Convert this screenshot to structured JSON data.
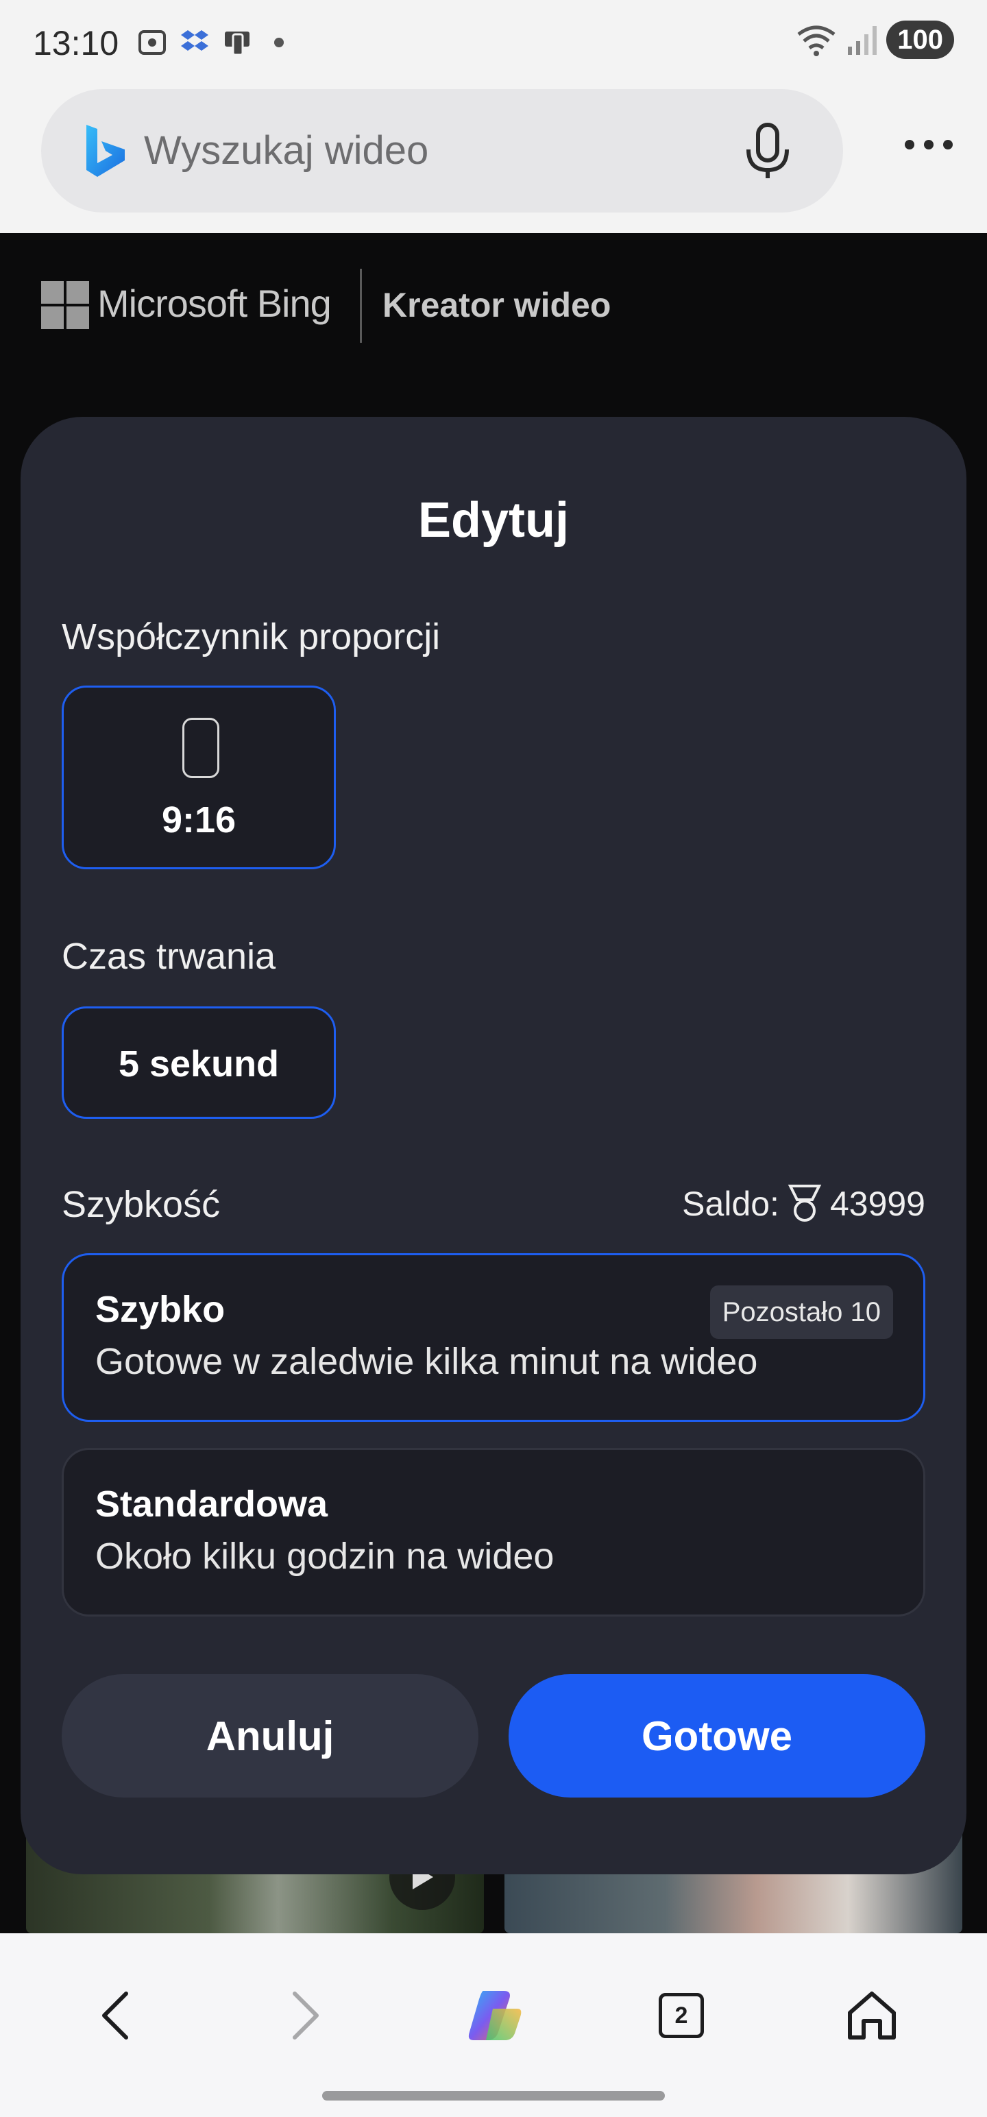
{
  "status_bar": {
    "time": "13:10",
    "battery": "100"
  },
  "browser": {
    "search_placeholder": "Wyszukaj wideo"
  },
  "header": {
    "brand": "Microsoft Bing",
    "section": "Kreator wideo"
  },
  "modal": {
    "title": "Edytuj",
    "aspect_ratio": {
      "label": "Współczynnik proporcji",
      "value": "9:16"
    },
    "duration": {
      "label": "Czas trwania",
      "value": "5 sekund"
    },
    "speed": {
      "label": "Szybkość",
      "balance_prefix": "Saldo:",
      "balance_value": "43999",
      "options": [
        {
          "name": "Szybko",
          "description": "Gotowe w zaledwie kilka minut na wideo",
          "badge": "Pozostało 10"
        },
        {
          "name": "Standardowa",
          "description": "Około kilku godzin na wideo"
        }
      ]
    },
    "buttons": {
      "cancel": "Anuluj",
      "done": "Gotowe"
    }
  },
  "bottom_nav": {
    "tabs_count": "2"
  },
  "colors": {
    "accent": "#1c5cf3",
    "modal_bg": "#262833",
    "card_bg": "#1c1d25"
  },
  "icons": [
    "bing-logo-icon",
    "microphone-icon",
    "more-icon",
    "microsoft-logo-icon",
    "phone-portrait-icon",
    "medal-icon",
    "play-icon",
    "back-arrow-icon",
    "forward-arrow-icon",
    "copilot-icon",
    "tabs-icon",
    "home-icon",
    "wifi-icon",
    "signal-icon"
  ]
}
